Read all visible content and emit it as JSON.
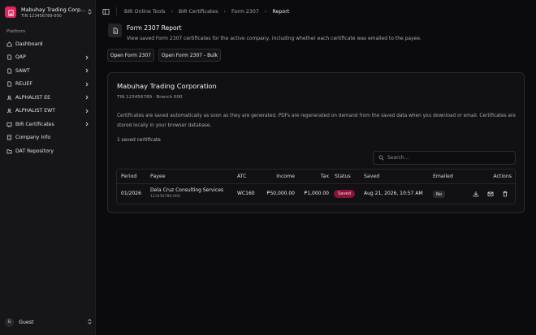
{
  "company": {
    "name": "Mabuhay Trading Corp...",
    "tin": "TIN 123456789-000"
  },
  "sidebar": {
    "section_label": "Platform",
    "items": [
      {
        "label": "Dashboard",
        "icon": "home-icon",
        "has_submenu": false
      },
      {
        "label": "QAP",
        "icon": "document-icon",
        "has_submenu": true
      },
      {
        "label": "SAWT",
        "icon": "document-icon",
        "has_submenu": true
      },
      {
        "label": "RELIEF",
        "icon": "document-icon",
        "has_submenu": true
      },
      {
        "label": "ALPHALIST EE",
        "icon": "users-icon",
        "has_submenu": true
      },
      {
        "label": "ALPHALIST EWT",
        "icon": "users-icon",
        "has_submenu": true
      },
      {
        "label": "BIR Certificates",
        "icon": "certificate-icon",
        "has_submenu": true
      },
      {
        "label": "Company Info",
        "icon": "building-icon",
        "has_submenu": false
      },
      {
        "label": "DAT Repository",
        "icon": "folder-icon",
        "has_submenu": false
      }
    ]
  },
  "user": {
    "initial": "G",
    "name": "Guest"
  },
  "breadcrumb": [
    "BIR Online Tools",
    "BIR Certificates",
    "Form 2307",
    "Report"
  ],
  "header": {
    "title": "Form 2307 Report",
    "subtitle": "View saved Form 2307 certificates for the active company, including whether each certificate was emailed to the payee."
  },
  "actions": {
    "open_form": "Open Form 2307",
    "open_bulk": "Open Form 2307 - Bulk"
  },
  "card": {
    "company_name": "Mabuhay Trading Corporation",
    "tin_branch": "TIN 123456789 · Branch 000",
    "description": "Certificates are saved automatically as soon as they are generated. PDFs are regenerated on demand from the saved data when you download or email. Certificates are stored locally in your browser database.",
    "count": "1 saved certificate",
    "search_placeholder": "Search..."
  },
  "table": {
    "columns": {
      "period": "Period",
      "payee": "Payee",
      "atc": "ATC",
      "income": "Income",
      "tax": "Tax",
      "status": "Status",
      "saved": "Saved",
      "emailed": "Emailed",
      "actions": "Actions"
    },
    "rows": [
      {
        "period": "01/2026",
        "payee_name": "Dela Cruz Consulting Services",
        "payee_tin": "123456789-000",
        "atc": "WC160",
        "income": "₱50,000.00",
        "tax": "₱1,000.00",
        "status": "Saved",
        "saved": "Aug 21, 2026, 10:57 AM",
        "emailed": "No"
      }
    ]
  },
  "colors": {
    "brand": "#e0245e",
    "saved_badge": "#8a1338",
    "background": "#0b0b0d",
    "sidebar": "#161618"
  }
}
